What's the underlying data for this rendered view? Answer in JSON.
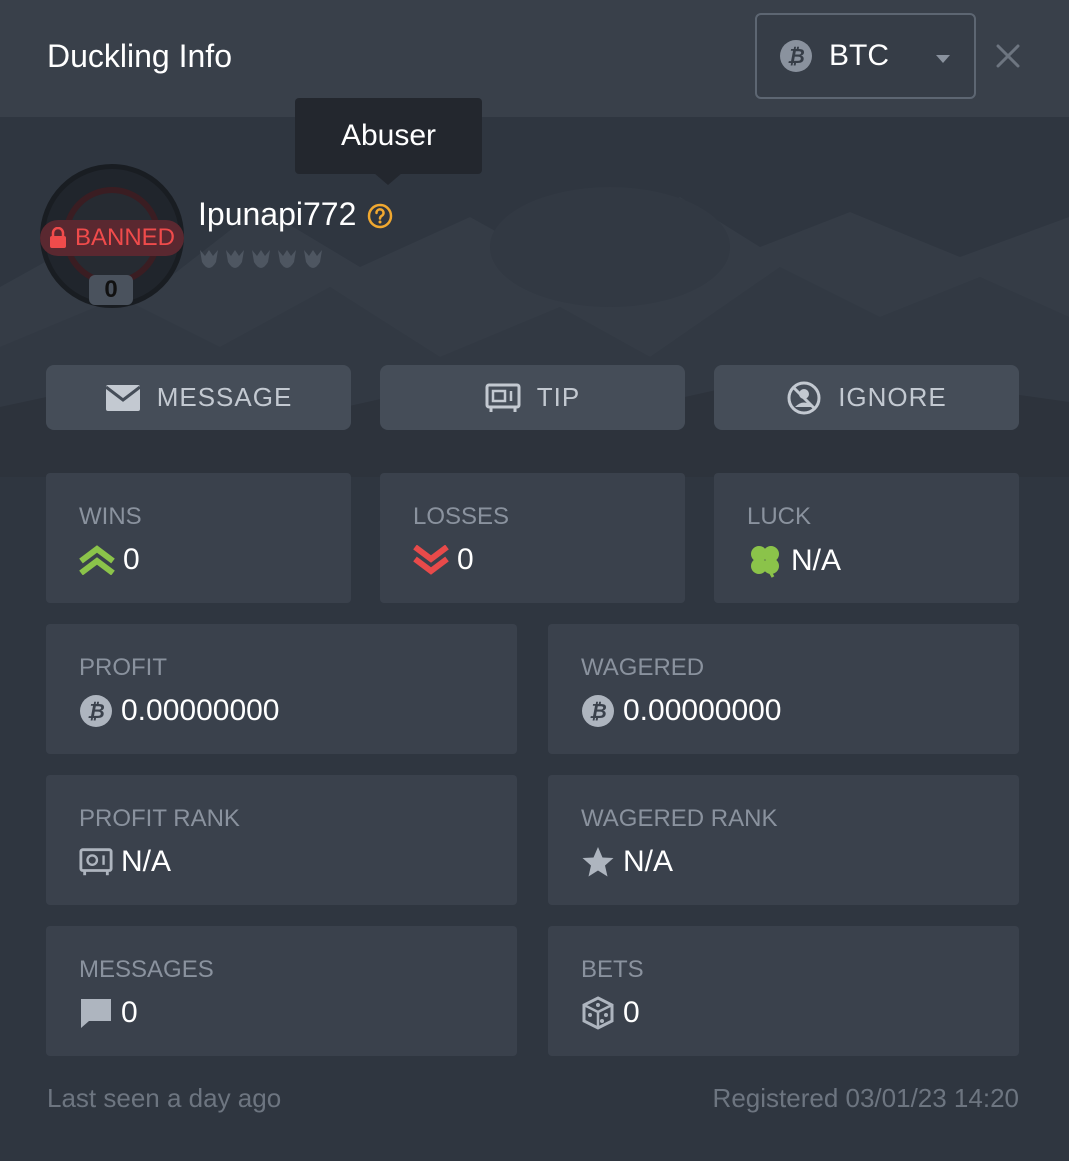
{
  "header": {
    "title": "Duckling Info",
    "currency": "BTC"
  },
  "profile": {
    "tooltip": "Abuser",
    "status_badge": "BANNED",
    "level": "0",
    "username": "Ipunapi772"
  },
  "actions": {
    "message": "MESSAGE",
    "tip": "TIP",
    "ignore": "IGNORE"
  },
  "stats": {
    "wins": {
      "label": "WINS",
      "value": "0"
    },
    "losses": {
      "label": "LOSSES",
      "value": "0"
    },
    "luck": {
      "label": "LUCK",
      "value": "N/A"
    },
    "profit": {
      "label": "PROFIT",
      "value": "0.00000000"
    },
    "wagered": {
      "label": "WAGERED",
      "value": "0.00000000"
    },
    "profit_rank": {
      "label": "PROFIT RANK",
      "value": "N/A"
    },
    "wagered_rank": {
      "label": "WAGERED RANK",
      "value": "N/A"
    },
    "messages": {
      "label": "MESSAGES",
      "value": "0"
    },
    "bets": {
      "label": "BETS",
      "value": "0"
    }
  },
  "footer": {
    "last_seen": "Last seen a day ago",
    "registered": "Registered 03/01/23 14:20"
  },
  "colors": {
    "background": "#2f3640",
    "card": "#3a414c",
    "banned": "#f04b4b",
    "wins": "#8bc34a",
    "losses": "#e84a4a",
    "help": "#f0a830"
  }
}
